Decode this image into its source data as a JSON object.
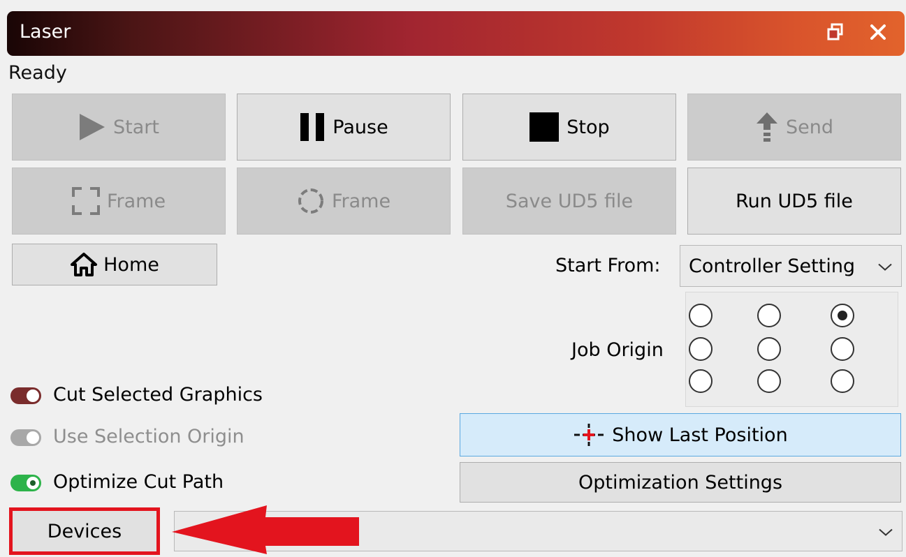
{
  "window": {
    "title": "Laser"
  },
  "status": "Ready",
  "buttons": {
    "start": "Start",
    "pause": "Pause",
    "stop": "Stop",
    "send": "Send",
    "frame_rect": "Frame",
    "frame_circle": "Frame",
    "save_ud5": "Save UD5 file",
    "run_ud5": "Run UD5 file",
    "home": "Home",
    "show_last_position": "Show Last Position",
    "optimization_settings": "Optimization Settings",
    "devices": "Devices"
  },
  "start_from": {
    "label": "Start From:",
    "value": "Controller Setting"
  },
  "job_origin": {
    "label": "Job Origin",
    "selected": "top-right"
  },
  "toggles": {
    "cut_selected": {
      "label": "Cut Selected Graphics",
      "state": "on"
    },
    "use_selection_origin": {
      "label": "Use Selection Origin",
      "state": "disabled"
    },
    "optimize_cut_path": {
      "label": "Optimize Cut Path",
      "state": "on"
    }
  },
  "devices_select": {
    "value": ""
  },
  "colors": {
    "toggle_red": "#7a2c2c",
    "toggle_green": "#2db34a",
    "annotation_red": "#e3141e",
    "highlight_blue": "#d6ebfa"
  },
  "icons": [
    "play-icon",
    "pause-icon",
    "stop-icon",
    "upload-icon",
    "frame-rect-icon",
    "frame-circle-icon",
    "home-icon",
    "crosshair-icon",
    "chevron-down-icon",
    "float-icon",
    "close-icon"
  ]
}
